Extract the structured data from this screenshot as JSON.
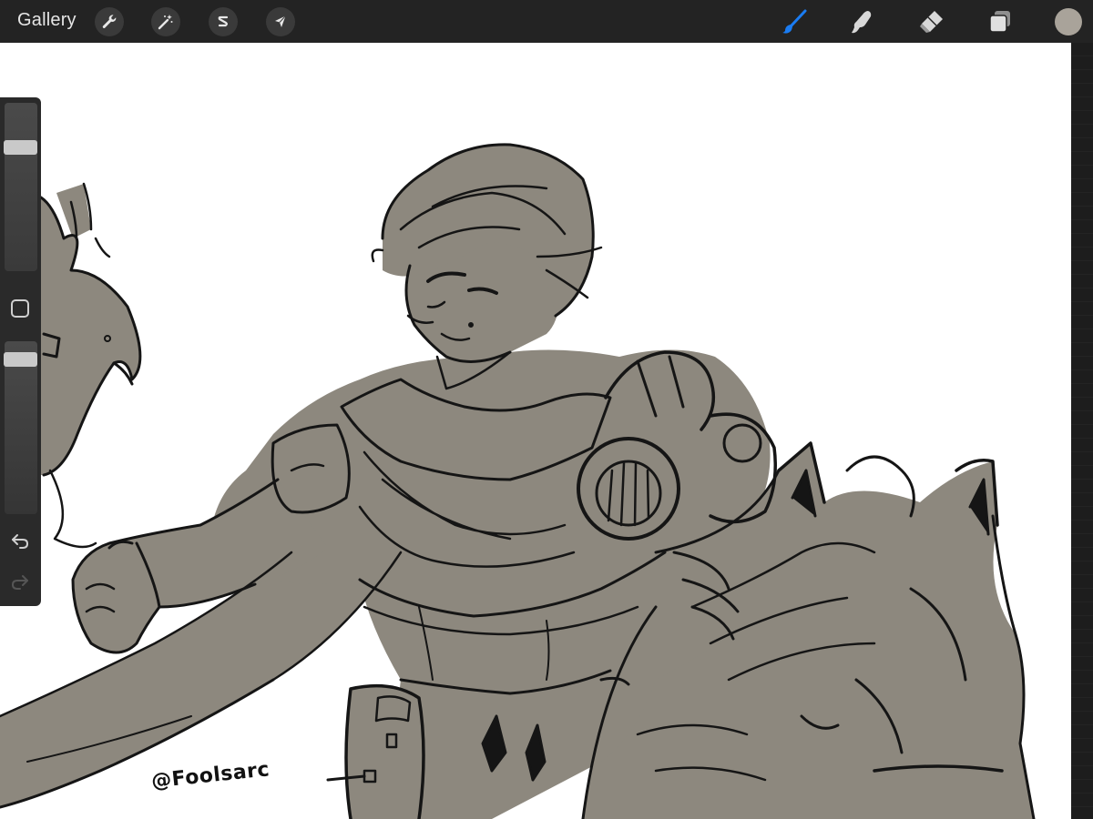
{
  "toolbar": {
    "gallery_label": "Gallery",
    "left_tools": [
      {
        "name": "actions",
        "icon": "wrench-icon"
      },
      {
        "name": "adjustments",
        "icon": "magic-wand-icon"
      },
      {
        "name": "selection",
        "icon": "selection-s-icon"
      },
      {
        "name": "transform",
        "icon": "arrow-cursor-icon"
      }
    ],
    "right_tools": [
      {
        "name": "brush",
        "icon": "brush-icon",
        "active": true
      },
      {
        "name": "smudge",
        "icon": "smudge-finger-icon",
        "active": false
      },
      {
        "name": "eraser",
        "icon": "eraser-icon",
        "active": false
      },
      {
        "name": "layers",
        "icon": "layers-icon",
        "active": false
      }
    ],
    "current_color": "#a9a39a",
    "active_tool_color": "#1a7cf2"
  },
  "sidebar": {
    "brush_size_level": 0.76,
    "opacity_level": 0.93,
    "undo_icon": "undo-arrow-icon",
    "redo_icon": "redo-arrow-icon",
    "modify_icon": "square-modify-icon"
  },
  "canvas": {
    "signature": "@Foolsarc",
    "fill_color": "#8d887e",
    "line_color": "#151515"
  }
}
